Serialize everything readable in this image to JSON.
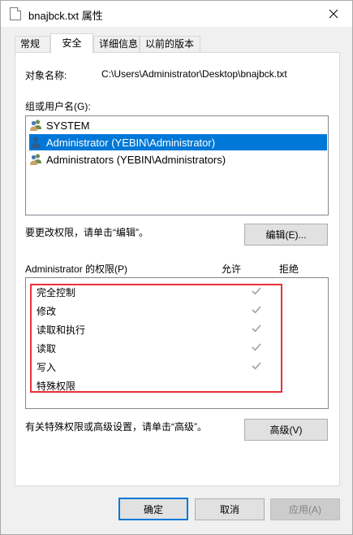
{
  "window": {
    "title": "bnajbck.txt 属性"
  },
  "tabs": [
    {
      "label": "常规"
    },
    {
      "label": "安全"
    },
    {
      "label": "详细信息"
    },
    {
      "label": "以前的版本"
    }
  ],
  "security": {
    "object_name_label": "对象名称:",
    "object_name_value": "C:\\Users\\Administrator\\Desktop\\bnajbck.txt",
    "group_label": "组或用户名(G):",
    "users": [
      {
        "name": "SYSTEM",
        "selected": false
      },
      {
        "name": "Administrator (YEBIN\\Administrator)",
        "selected": true
      },
      {
        "name": "Administrators (YEBIN\\Administrators)",
        "selected": false
      }
    ],
    "edit_hint": "要更改权限，请单击“编辑”。",
    "edit_button": "编辑(E)...",
    "perm_header": "Administrator 的权限(P)",
    "allow_header": "允许",
    "deny_header": "拒绝",
    "permissions": [
      {
        "name": "完全控制",
        "allow": true
      },
      {
        "name": "修改",
        "allow": true
      },
      {
        "name": "读取和执行",
        "allow": true
      },
      {
        "name": "读取",
        "allow": true
      },
      {
        "name": "写入",
        "allow": true
      },
      {
        "name": "特殊权限",
        "allow": false
      }
    ],
    "advanced_hint": "有关特殊权限或高级设置，请单击“高级”。",
    "advanced_button": "高级(V)"
  },
  "footer": {
    "ok": "确定",
    "cancel": "取消",
    "apply": "应用(A)"
  },
  "colors": {
    "selection": "#0078d7",
    "highlight_box": "#e8313a",
    "check_disabled": "#a0a0a0"
  }
}
